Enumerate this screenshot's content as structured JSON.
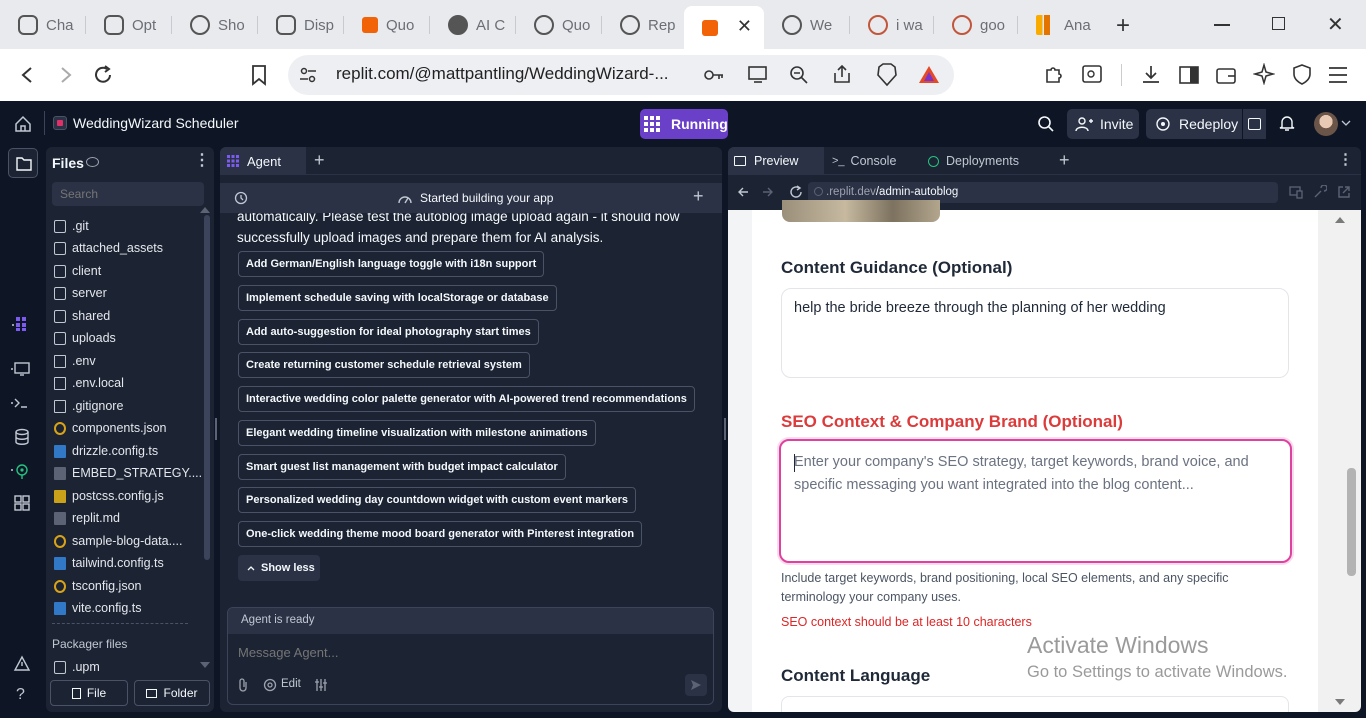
{
  "browser": {
    "tabs": [
      {
        "label": "Cha"
      },
      {
        "label": "Opt"
      },
      {
        "label": "Sho"
      },
      {
        "label": "Disp"
      },
      {
        "label": "Quo"
      },
      {
        "label": "AI C"
      },
      {
        "label": "Quo"
      },
      {
        "label": "Rep"
      },
      {
        "label": ""
      },
      {
        "label": "We"
      },
      {
        "label": "i wa"
      },
      {
        "label": "goo"
      },
      {
        "label": "Ana"
      }
    ],
    "url": "replit.com/@mattpantling/WeddingWizard-..."
  },
  "replit": {
    "project_name": "WeddingWizard Scheduler",
    "run_status": "Running",
    "invite_label": "Invite",
    "redeploy_label": "Redeploy"
  },
  "files": {
    "title": "Files",
    "search_placeholder": "Search",
    "items": [
      {
        "name": ".git",
        "type": "folder"
      },
      {
        "name": "attached_assets",
        "type": "folder"
      },
      {
        "name": "client",
        "type": "folder"
      },
      {
        "name": "server",
        "type": "folder"
      },
      {
        "name": "shared",
        "type": "folder"
      },
      {
        "name": "uploads",
        "type": "folder"
      },
      {
        "name": ".env",
        "type": "file"
      },
      {
        "name": ".env.local",
        "type": "file"
      },
      {
        "name": ".gitignore",
        "type": "file"
      },
      {
        "name": "components.json",
        "type": "json"
      },
      {
        "name": "drizzle.config.ts",
        "type": "ts"
      },
      {
        "name": "EMBED_STRATEGY....",
        "type": "md"
      },
      {
        "name": "postcss.config.js",
        "type": "js"
      },
      {
        "name": "replit.md",
        "type": "md"
      },
      {
        "name": "sample-blog-data....",
        "type": "json"
      },
      {
        "name": "tailwind.config.ts",
        "type": "ts"
      },
      {
        "name": "tsconfig.json",
        "type": "json"
      },
      {
        "name": "vite.config.ts",
        "type": "ts"
      }
    ],
    "packager_title": "Packager files",
    "packager_items": [
      {
        "name": ".upm",
        "type": "folder"
      }
    ],
    "new_file_label": "File",
    "new_folder_label": "Folder"
  },
  "agent": {
    "tab_label": "Agent",
    "status_title": "Started building your app",
    "message_line1": "automatically. Please test the autoblog image upload again - it should now",
    "message_line2": "successfully upload images and prepare them for AI analysis.",
    "suggestions": [
      "Add German/English language toggle with i18n support",
      "Implement schedule saving with localStorage or database",
      "Add auto-suggestion for ideal photography start times",
      "Create returning customer schedule retrieval system",
      "Interactive wedding color palette generator with AI-powered trend recommendations",
      "Elegant wedding timeline visualization with milestone animations",
      "Smart guest list management with budget impact calculator",
      "Personalized wedding day countdown widget with custom event markers",
      "One-click wedding theme mood board generator with Pinterest integration"
    ],
    "show_less_label": "Show less",
    "ready_text": "Agent is ready",
    "input_placeholder": "Message Agent...",
    "edit_label": "Edit"
  },
  "preview": {
    "tabs": [
      "Preview",
      "Console",
      "Deployments"
    ],
    "url_prefix": ".replit.dev",
    "url_path": "/admin-autoblog",
    "content_guidance_label": "Content Guidance (Optional)",
    "content_guidance_value": "help the bride breeze through the planning of her wedding",
    "seo_label": "SEO Context & Company Brand (Optional)",
    "seo_placeholder": "Enter your company's SEO strategy, target keywords, brand voice, and specific messaging you want integrated into the blog content...",
    "seo_help": "Include target keywords, brand positioning, local SEO elements, and any specific terminology your company uses.",
    "seo_error": "SEO context should be at least 10 characters",
    "content_language_label": "Content Language"
  },
  "watermark": {
    "line1": "Activate Windows",
    "line2": "Go to Settings to activate Windows."
  },
  "colors": {
    "accent_purple": "#6b40c9",
    "error_red": "#dc3b3b",
    "focus_pink": "#e040a0",
    "panel_bg": "#1c2333",
    "app_bg": "#0e1525"
  }
}
